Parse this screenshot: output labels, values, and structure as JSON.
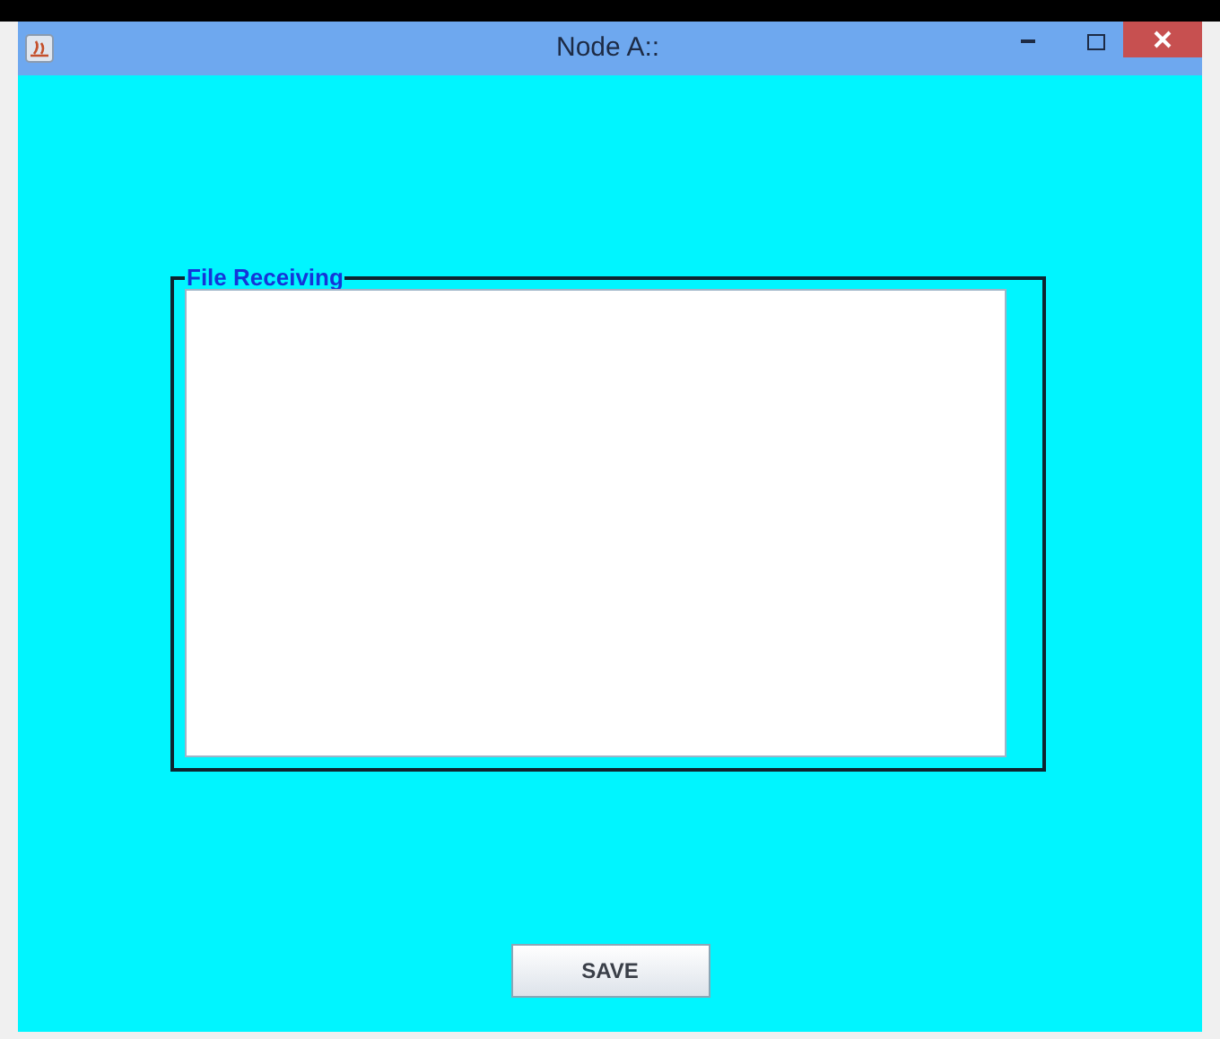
{
  "window": {
    "title": "Node A::"
  },
  "panel": {
    "title": "File Receiving"
  },
  "buttons": [
    "SAVE"
  ]
}
